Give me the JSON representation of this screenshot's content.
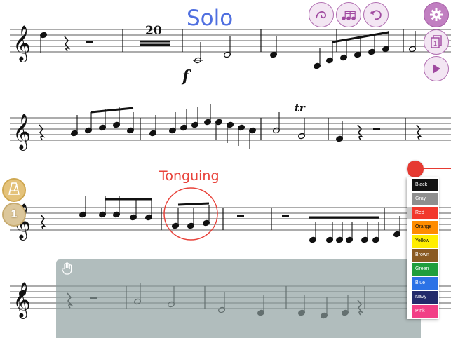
{
  "annotations": {
    "solo": "Solo",
    "tonguing": "Tonguing",
    "rehearsal_mark": "20",
    "dynamic": "f",
    "trill": "tr"
  },
  "toolbar": {
    "curve_icon": "slur-curve-icon",
    "notes_icon": "triplet-notes-icon",
    "undo_icon": "undo-icon",
    "settings_icon": "gear-icon",
    "pages_icon": "pages-icon",
    "play_icon": "play-icon"
  },
  "side": {
    "metronome_icon": "metronome-icon",
    "part_number": "1"
  },
  "palette": {
    "colors": [
      {
        "label": "Black",
        "hex": "#111111",
        "text": "#ffffff"
      },
      {
        "label": "Gray",
        "hex": "#8e8e8e",
        "text": "#ffffff"
      },
      {
        "label": "Red",
        "hex": "#f2372c",
        "text": "#ffffff"
      },
      {
        "label": "Orange",
        "hex": "#ff8c00",
        "text": "#111111"
      },
      {
        "label": "Yellow",
        "hex": "#ffee00",
        "text": "#111111"
      },
      {
        "label": "Brown",
        "hex": "#8a5a22",
        "text": "#ffffff"
      },
      {
        "label": "Green",
        "hex": "#1f9e3c",
        "text": "#ffffff"
      },
      {
        "label": "Blue",
        "hex": "#2b72e6",
        "text": "#ffffff"
      },
      {
        "label": "Navy",
        "hex": "#232a6b",
        "text": "#ffffff"
      },
      {
        "label": "Pink",
        "hex": "#f23f86",
        "text": "#ffffff"
      }
    ]
  },
  "colors": {
    "ink": "#111111",
    "blue_annotation": "#4f6fe0",
    "red_annotation": "#e8423a",
    "accent": "#b06cb0"
  }
}
